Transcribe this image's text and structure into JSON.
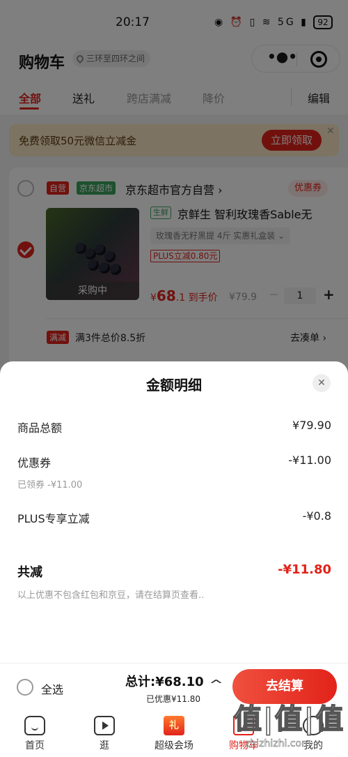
{
  "status": {
    "time": "20:17",
    "network": "5G",
    "battery": "92"
  },
  "header": {
    "title": "购物车",
    "location": "三环至四环之间"
  },
  "tabs": [
    {
      "label": "全部"
    },
    {
      "label": "送礼"
    },
    {
      "label": "跨店满减"
    },
    {
      "label": "降价"
    },
    {
      "label": "编辑"
    }
  ],
  "banner": {
    "text": "免费领取50元微信立减金",
    "button": "立即领取"
  },
  "shop": {
    "self_tag": "自营",
    "market_tag": "京东超市",
    "name": "京东超市官方自营 ›",
    "coupon_tag": "优惠券"
  },
  "product": {
    "thumb_status": "采购中",
    "fresh_tag": "生鲜",
    "title": "京鲜生 智利玫瑰香Sable无",
    "spec": "玫瑰香无籽黑提 4斤 实惠礼盒装 ⌄",
    "plus_tag": "PLUS立减0.80元",
    "price_symbol": "¥",
    "price_int": "68",
    "price_dec": ".1",
    "price_suffix": " 到手价",
    "orig_price": "¥79.9",
    "qty": "1"
  },
  "promo": {
    "tag": "满减",
    "text": "满3件总价8.5折",
    "link": "去凑单 ›"
  },
  "sheet": {
    "title": "金额明细",
    "rows": [
      {
        "label": "商品总额",
        "value": "¥79.90"
      },
      {
        "label": "优惠券",
        "value": "-¥11.00",
        "sub": "已领券 -¥11.00"
      },
      {
        "label": "PLUS专享立减",
        "value": "-¥0.8"
      }
    ],
    "total_label": "共减",
    "total_value": "-¥11.80",
    "note": "以上优惠不包含红包和京豆，请在结算页查看.."
  },
  "checkout": {
    "select_all": "全选",
    "total": "总计:¥68.10",
    "saved": "已优惠¥11.80",
    "button": "去结算"
  },
  "nav": [
    {
      "label": "首页"
    },
    {
      "label": "逛"
    },
    {
      "label": "超级会场",
      "icon_text": "礼"
    },
    {
      "label": "购物车"
    },
    {
      "label": "我的"
    }
  ],
  "watermark": {
    "text": "值|值|值",
    "sub": "zhizhizhi.com"
  },
  "colors": {
    "accent": "#e2231a",
    "banner_bg": "#fbe6c4",
    "fresh_green": "#3aa15c"
  }
}
